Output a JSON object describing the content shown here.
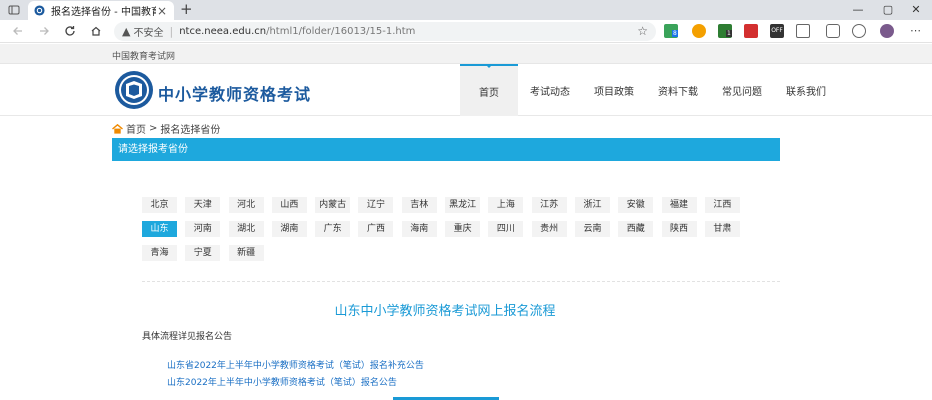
{
  "browser": {
    "tab_title": "报名选择省份 - 中国教育考试网",
    "tab_close": "×",
    "new_tab": "+",
    "window_controls": [
      "—",
      "▢",
      "✕"
    ],
    "security_label": "不安全",
    "url_host": "ntce.neea.edu.cn",
    "url_path": "/html1/folder/16013/15-1.htm",
    "ext_badges": [
      "8",
      "1"
    ],
    "ext_off_label": "OFF"
  },
  "site": {
    "top_strip": "中国教育考试网",
    "title": "中小学教师资格考试",
    "nav": [
      "首页",
      "考试动态",
      "项目政策",
      "资料下载",
      "常见问题",
      "联系我们"
    ],
    "nav_active_index": 0,
    "colors": {
      "primary": "#1ea8dd",
      "title": "#1c5a9e",
      "link": "#1a6fc4"
    }
  },
  "breadcrumb": {
    "home": "首页",
    "sep": ">",
    "current": "报名选择省份"
  },
  "section_header": "请选择报考省份",
  "provinces": {
    "rows": [
      [
        "北京",
        "天津",
        "河北",
        "山西",
        "内蒙古",
        "辽宁",
        "吉林",
        "黑龙江",
        "上海",
        "江苏",
        "浙江",
        "安徽",
        "福建",
        "江西"
      ],
      [
        "山东",
        "河南",
        "湖北",
        "湖南",
        "广东",
        "广西",
        "海南",
        "重庆",
        "四川",
        "贵州",
        "云南",
        "西藏",
        "陕西",
        "甘肃"
      ],
      [
        "青海",
        "宁夏",
        "新疆"
      ]
    ],
    "selected": "山东"
  },
  "flow": {
    "title": "山东中小学教师资格考试网上报名流程",
    "subtitle": "具体流程详见报名公告",
    "notices": [
      "山东省2022年上半年中小学教师资格考试（笔试）报名补充公告",
      "山东2022年上半年中小学教师资格考试（笔试）报名公告"
    ]
  }
}
